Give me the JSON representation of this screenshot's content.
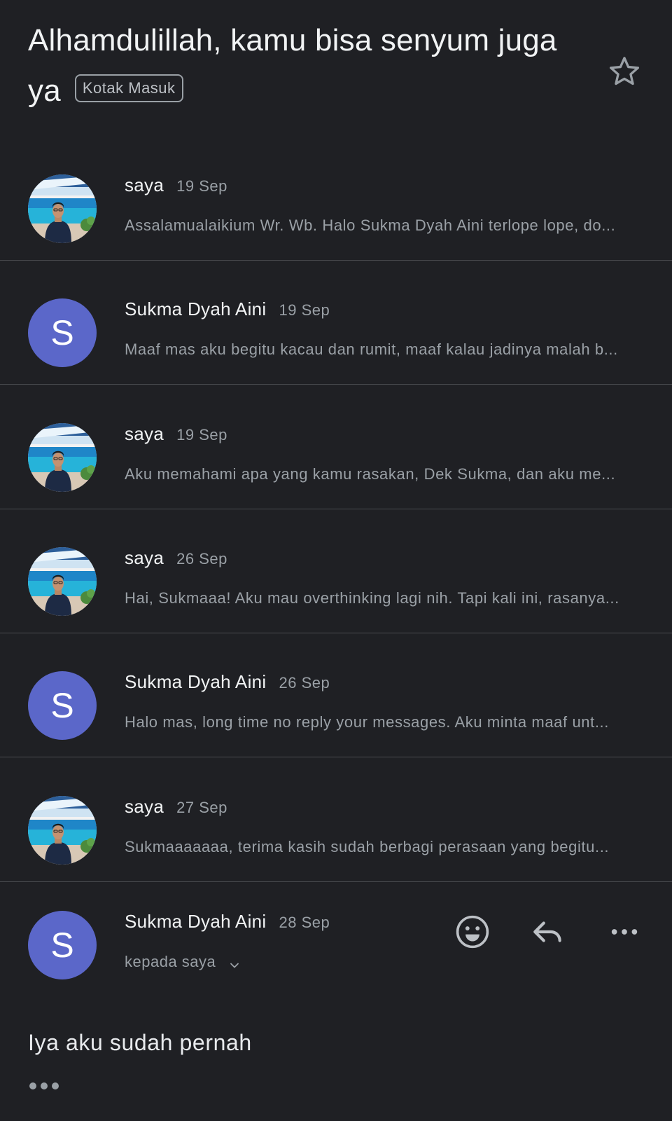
{
  "thread": {
    "subject": "Alhamdulillah, kamu bisa senyum juga ya",
    "label": "Kotak Masuk",
    "starred": false
  },
  "messages": [
    {
      "sender": "saya",
      "date": "19 Sep",
      "avatar": "photo",
      "snippet": "Assalamualaikium Wr. Wb. Halo Sukma Dyah Aini terlope lope, do..."
    },
    {
      "sender": "Sukma Dyah Aini",
      "date": "19 Sep",
      "avatar": "S",
      "snippet": "Maaf mas aku begitu kacau dan rumit, maaf kalau jadinya malah b..."
    },
    {
      "sender": "saya",
      "date": "19 Sep",
      "avatar": "photo",
      "snippet": "Aku memahami apa yang kamu rasakan, Dek Sukma, dan aku me..."
    },
    {
      "sender": "saya",
      "date": "26 Sep",
      "avatar": "photo",
      "snippet": "Hai, Sukmaaa! Aku mau overthinking lagi nih. Tapi kali ini, rasanya..."
    },
    {
      "sender": "Sukma Dyah Aini",
      "date": "26 Sep",
      "avatar": "S",
      "snippet": "Halo mas, long time no reply your messages. Aku minta maaf unt..."
    },
    {
      "sender": "saya",
      "date": "27 Sep",
      "avatar": "photo",
      "snippet": "Sukmaaaaaaa, terima kasih sudah berbagi perasaan yang begitu..."
    }
  ],
  "expanded": {
    "sender": "Sukma Dyah Aini",
    "date": "28 Sep",
    "avatar": "S",
    "recipient": "kepada saya",
    "body": "Iya aku sudah pernah",
    "actions": [
      "emoji-reaction",
      "reply",
      "more-options"
    ]
  },
  "colors": {
    "background": "#1f2024",
    "avatar_letter_bg": "#5b67c9",
    "divider": "#4a4c50",
    "muted_text": "#9aa0a6"
  }
}
